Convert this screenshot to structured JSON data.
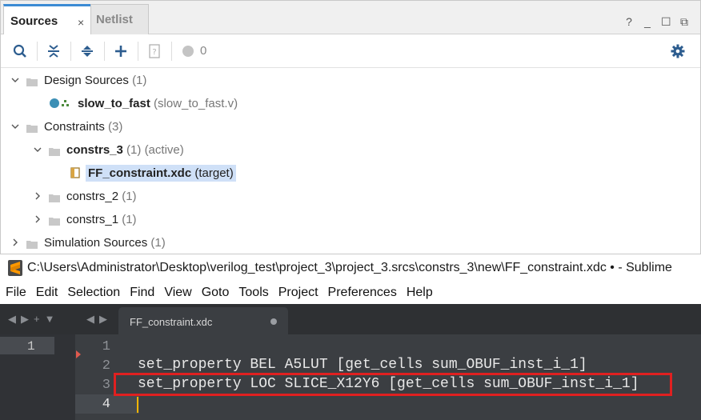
{
  "vivado": {
    "tabs": [
      {
        "label": "Sources",
        "close": "×"
      },
      {
        "label": "Netlist"
      }
    ],
    "window_controls": [
      "?",
      "_",
      "☐",
      "⧉"
    ],
    "toolbar": {
      "warning_count": "0"
    },
    "tree": {
      "design_sources": {
        "label": "Design Sources",
        "count": "(1)"
      },
      "slow_to_fast": {
        "label": "slow_to_fast",
        "file": "(slow_to_fast.v)"
      },
      "constraints": {
        "label": "Constraints",
        "count": "(3)"
      },
      "constrs_3": {
        "label": "constrs_3",
        "count": "(1)",
        "status": "(active)"
      },
      "ff_constraint": {
        "label": "FF_constraint.xdc",
        "status": "(target)"
      },
      "constrs_2": {
        "label": "constrs_2",
        "count": "(1)"
      },
      "constrs_1": {
        "label": "constrs_1",
        "count": "(1)"
      },
      "simulation_sources": {
        "label": "Simulation Sources",
        "count": "(1)"
      }
    }
  },
  "sublime": {
    "title": "C:\\Users\\Administrator\\Desktop\\verilog_test\\project_3\\project_3.srcs\\constrs_3\\new\\FF_constraint.xdc • - Sublime",
    "menu": [
      "File",
      "Edit",
      "Selection",
      "Find",
      "View",
      "Goto",
      "Tools",
      "Project",
      "Preferences",
      "Help"
    ],
    "tab_nav_left": [
      "◀",
      "▶",
      "+",
      "▼"
    ],
    "tab_nav_right": [
      "◀",
      "▶"
    ],
    "active_tab": "FF_constraint.xdc",
    "sidebar_line": "1",
    "line_numbers": [
      "1",
      "2",
      "3",
      "4"
    ],
    "code_lines": [
      "",
      "set_property BEL A5LUT [get_cells sum_OBUF_inst_i_1]",
      "set_property LOC SLICE_X12Y6 [get_cells sum_OBUF_inst_i_1]",
      ""
    ]
  },
  "colors": {
    "vivado_accent": "#3c8bd4",
    "selection": "#cfe0f7",
    "sublime_bg": "#3b3e42",
    "highlight_box": "#e02020",
    "caret": "#f0b400"
  }
}
